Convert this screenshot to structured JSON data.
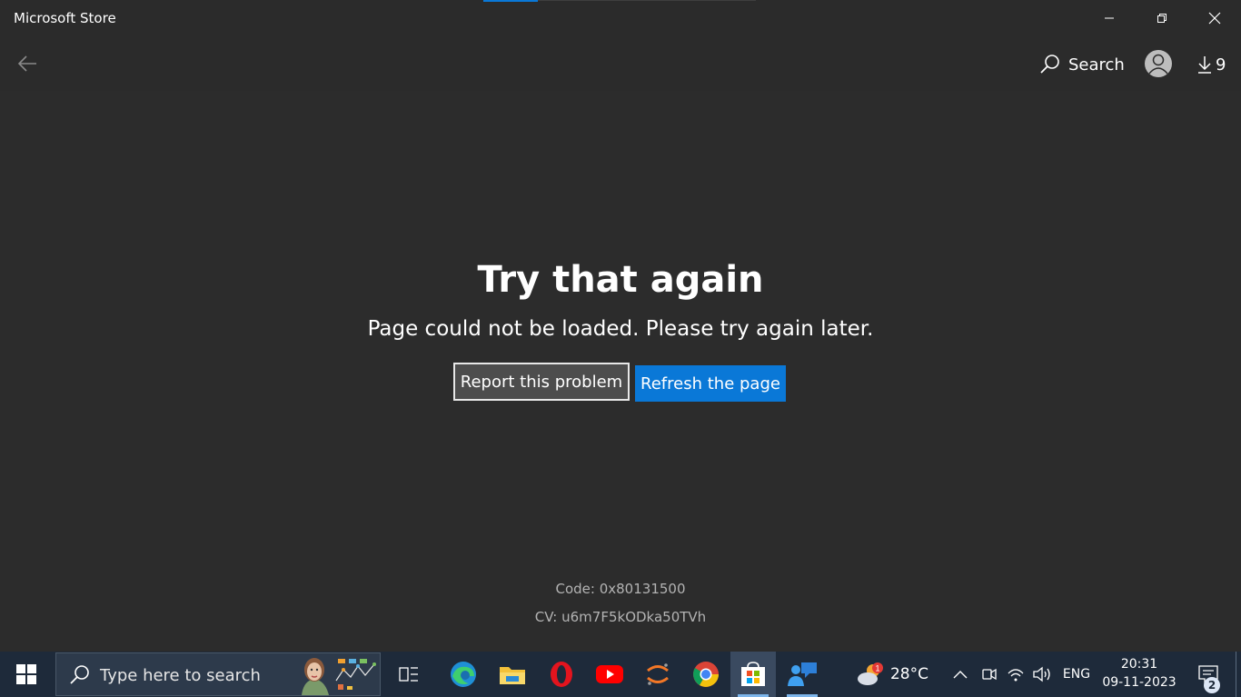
{
  "window": {
    "title": "Microsoft Store"
  },
  "header": {
    "search_label": "Search",
    "downloads_count": "9"
  },
  "error": {
    "title": "Try that again",
    "message": "Page could not be loaded. Please try again later.",
    "report_button": "Report this problem",
    "refresh_button": "Refresh the page",
    "code": "Code: 0x80131500",
    "cv": "CV: u6m7F5kODka50TVh"
  },
  "taskbar": {
    "search_placeholder": "Type here to search",
    "apps": [
      "task-view",
      "edge",
      "file-explorer",
      "opera",
      "youtube",
      "jupyter",
      "chrome",
      "microsoft-store",
      "feedback-hub"
    ],
    "weather": {
      "temp": "28°C",
      "alert_count": "1"
    },
    "language": "ENG",
    "time": "20:31",
    "date": "09-11-2023",
    "notification_count": "2"
  },
  "colors": {
    "accent": "#0a78d7",
    "background": "#2c2c2c",
    "taskbar": "#1e2a3a"
  }
}
